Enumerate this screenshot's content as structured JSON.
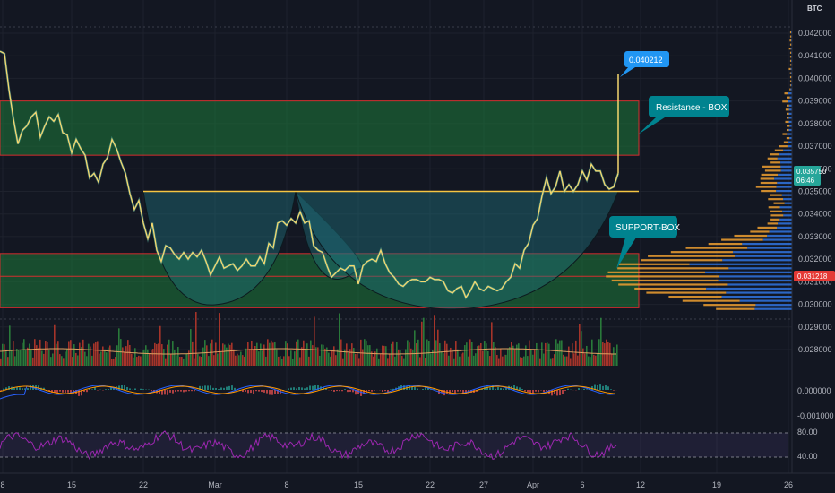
{
  "currency_badge": "BTC",
  "colors": {
    "background": "#131722",
    "grid": "#2a2e39",
    "box_fill": "#1e7a3a",
    "box_border": "#d32f2f",
    "cup_fill": "#1f6f7a",
    "price_line": "#f5d76e",
    "price_shadow": "#4da89c",
    "neckline": "#f5c542",
    "vp_up": "#2f6fd6",
    "vp_down": "#f0a030",
    "vol_up": "#2e8b3e",
    "vol_down": "#c0392b",
    "current_price_tag": "#26a69a",
    "poc_tag": "#e53935",
    "target_tag": "#2196f3",
    "resistance_tag": "#00838f",
    "rsi_line": "#8e24aa"
  },
  "chart_data": {
    "type": "line",
    "title": "",
    "price_axis": {
      "ticks": [
        "0.042000",
        "0.041000",
        "0.040000",
        "0.039000",
        "0.038000",
        "0.037000",
        "0.036000",
        "0.035000",
        "0.034000",
        "0.033000",
        "0.032000",
        "0.031000",
        "0.030000",
        "0.029000",
        "0.028000"
      ],
      "range": [
        0.0275,
        0.0428
      ]
    },
    "x_axis_ticks": [
      "8",
      "15",
      "22",
      "Mar",
      "8",
      "15",
      "22",
      "27",
      "Apr",
      "6",
      "12",
      "19",
      "26"
    ],
    "price_series": {
      "name": "",
      "x": [
        0,
        5,
        10,
        15,
        20,
        25,
        30,
        35,
        40,
        45,
        50,
        55,
        60,
        65,
        70,
        75,
        80,
        85,
        90,
        95,
        100,
        105,
        110,
        115,
        120,
        125,
        130,
        135,
        140,
        145,
        150,
        155,
        160,
        165,
        170,
        175,
        180,
        185,
        190,
        195,
        200,
        205,
        210,
        215,
        220,
        225,
        230,
        235,
        240,
        245,
        250,
        255,
        260,
        265,
        270,
        275,
        280,
        285,
        290,
        295,
        300,
        305,
        310,
        315,
        320,
        325,
        330,
        335,
        340,
        345,
        350,
        355,
        360,
        365,
        370,
        375,
        380,
        385,
        390,
        395,
        400,
        405,
        410,
        415,
        420,
        425,
        430,
        435,
        440,
        445,
        450,
        455,
        460,
        465,
        470,
        475,
        480,
        485,
        490,
        495,
        500,
        505,
        510,
        515,
        520,
        525,
        530,
        535,
        540,
        545,
        550,
        555,
        560,
        565,
        570,
        575,
        580,
        585,
        590,
        595,
        600,
        605,
        610,
        615,
        620,
        625,
        630,
        635,
        640,
        645,
        650,
        655,
        660,
        665,
        670,
        675,
        680,
        685,
        690
      ],
      "y": [
        0.0412,
        0.0411,
        0.0395,
        0.0382,
        0.0371,
        0.0377,
        0.0379,
        0.0383,
        0.0385,
        0.0374,
        0.0379,
        0.0383,
        0.0381,
        0.0384,
        0.0376,
        0.0375,
        0.0367,
        0.0373,
        0.0369,
        0.0366,
        0.0356,
        0.0358,
        0.0354,
        0.0362,
        0.0365,
        0.0373,
        0.0369,
        0.0363,
        0.0358,
        0.0349,
        0.0342,
        0.0346,
        0.0336,
        0.0329,
        0.0336,
        0.0324,
        0.0319,
        0.0326,
        0.0325,
        0.0322,
        0.032,
        0.0323,
        0.032,
        0.0323,
        0.0321,
        0.0324,
        0.0319,
        0.0313,
        0.0317,
        0.0321,
        0.0316,
        0.0317,
        0.0318,
        0.0315,
        0.0317,
        0.032,
        0.0317,
        0.0317,
        0.0321,
        0.0318,
        0.0327,
        0.0325,
        0.0336,
        0.0337,
        0.0335,
        0.0338,
        0.0336,
        0.0341,
        0.0336,
        0.0337,
        0.0326,
        0.0324,
        0.0323,
        0.0317,
        0.0312,
        0.0314,
        0.0316,
        0.0315,
        0.0317,
        0.0317,
        0.0309,
        0.0317,
        0.0319,
        0.032,
        0.0319,
        0.0324,
        0.0318,
        0.0314,
        0.0312,
        0.0309,
        0.0308,
        0.031,
        0.0311,
        0.0311,
        0.031,
        0.031,
        0.0312,
        0.0311,
        0.0311,
        0.031,
        0.0306,
        0.0305,
        0.0307,
        0.0308,
        0.0303,
        0.0306,
        0.031,
        0.0307,
        0.0306,
        0.0308,
        0.0307,
        0.0306,
        0.0307,
        0.031,
        0.0312,
        0.0318,
        0.0316,
        0.0324,
        0.0327,
        0.0335,
        0.0338,
        0.0348,
        0.0356,
        0.0349,
        0.0352,
        0.0359,
        0.035,
        0.0353,
        0.035,
        0.0353,
        0.0359,
        0.0355,
        0.0362,
        0.0359,
        0.0359,
        0.0353,
        0.0351,
        0.0352,
        0.0358
      ]
    },
    "spike": {
      "from": 0.0358,
      "to": 0.040212
    },
    "resistance_box": {
      "top": 0.039,
      "bottom": 0.0366
    },
    "support_box": {
      "top": 0.03225,
      "bottom": 0.02985
    },
    "neckline": 0.035,
    "horizontal_line": 0.03124,
    "labels": {
      "current_price": "0.035750",
      "countdown": "06:46",
      "poc_price": "0.031218",
      "target_price": "0.040212",
      "resistance": "Resistance - BOX",
      "support": "SUPPORT-BOX"
    },
    "macd_axis": {
      "ticks": [
        "0.000000",
        "-0.001000"
      ]
    },
    "rsi_axis": {
      "ticks": [
        "80.00",
        "40.00"
      ],
      "bands": [
        80,
        40
      ]
    }
  }
}
